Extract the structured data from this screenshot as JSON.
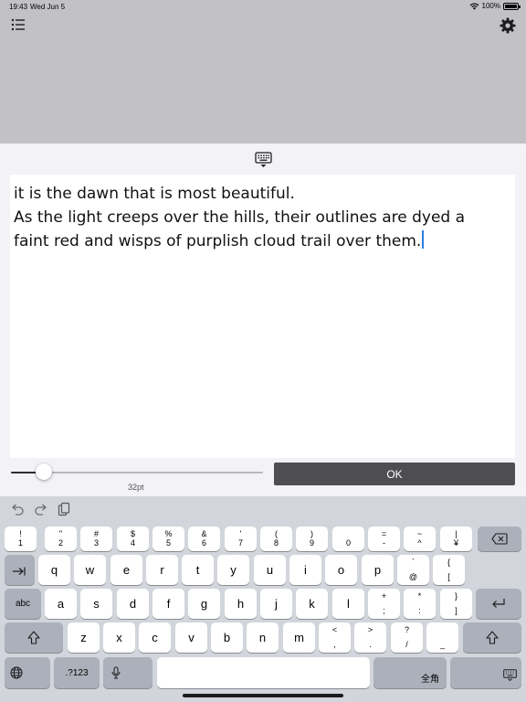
{
  "status_bar": {
    "time": "19:43",
    "date": "Wed Jun 5",
    "battery_percent": "100%",
    "battery_level": 1.0
  },
  "toolbar": {
    "list_icon": "list-icon",
    "settings_icon": "gear-icon"
  },
  "editor": {
    "dismiss_icon": "keyboard-dismiss-icon",
    "lines": [
      "it is the dawn that is most beautiful.",
      "As the light creeps over the hills, their outlines are dyed a",
      "faint red and wisps of purplish cloud trail over them."
    ],
    "font_size_label": "32pt",
    "font_size_slider_fraction": 0.13,
    "ok_label": "OK"
  },
  "keyboard": {
    "toolbar_icons": [
      "undo-icon",
      "redo-icon",
      "clipboard-icon"
    ],
    "number_row": [
      {
        "top": "!",
        "bottom": "1"
      },
      {
        "top": "\"",
        "bottom": "2"
      },
      {
        "top": "#",
        "bottom": "3"
      },
      {
        "top": "$",
        "bottom": "4"
      },
      {
        "top": "%",
        "bottom": "5"
      },
      {
        "top": "&",
        "bottom": "6"
      },
      {
        "top": "'",
        "bottom": "7"
      },
      {
        "top": "(",
        "bottom": "8"
      },
      {
        "top": ")",
        "bottom": "9"
      },
      {
        "top": "",
        "bottom": "0"
      },
      {
        "top": "=",
        "bottom": "-"
      },
      {
        "top": "~",
        "bottom": "^"
      },
      {
        "top": "|",
        "bottom": "¥"
      }
    ],
    "row2_letters": [
      "q",
      "w",
      "e",
      "r",
      "t",
      "y",
      "u",
      "i",
      "o",
      "p"
    ],
    "row2_symbols": [
      {
        "top": "`",
        "bottom": "@"
      },
      {
        "top": "{",
        "bottom": "["
      }
    ],
    "row3_label": "abc",
    "row3_letters": [
      "a",
      "s",
      "d",
      "f",
      "g",
      "h",
      "j",
      "k",
      "l"
    ],
    "row3_symbols": [
      {
        "top": "+",
        "bottom": ";"
      },
      {
        "top": "*",
        "bottom": ":"
      },
      {
        "top": "}",
        "bottom": "]"
      }
    ],
    "row4_letters": [
      "z",
      "x",
      "c",
      "v",
      "b",
      "n",
      "m"
    ],
    "row4_symbols": [
      {
        "top": "<",
        "bottom": ","
      },
      {
        "top": ">",
        "bottom": "."
      },
      {
        "top": "?",
        "bottom": "/"
      },
      {
        "top": "",
        "bottom": "_"
      }
    ],
    "numbers_label": ".?123",
    "space_label": "",
    "lang_label": "全角"
  }
}
